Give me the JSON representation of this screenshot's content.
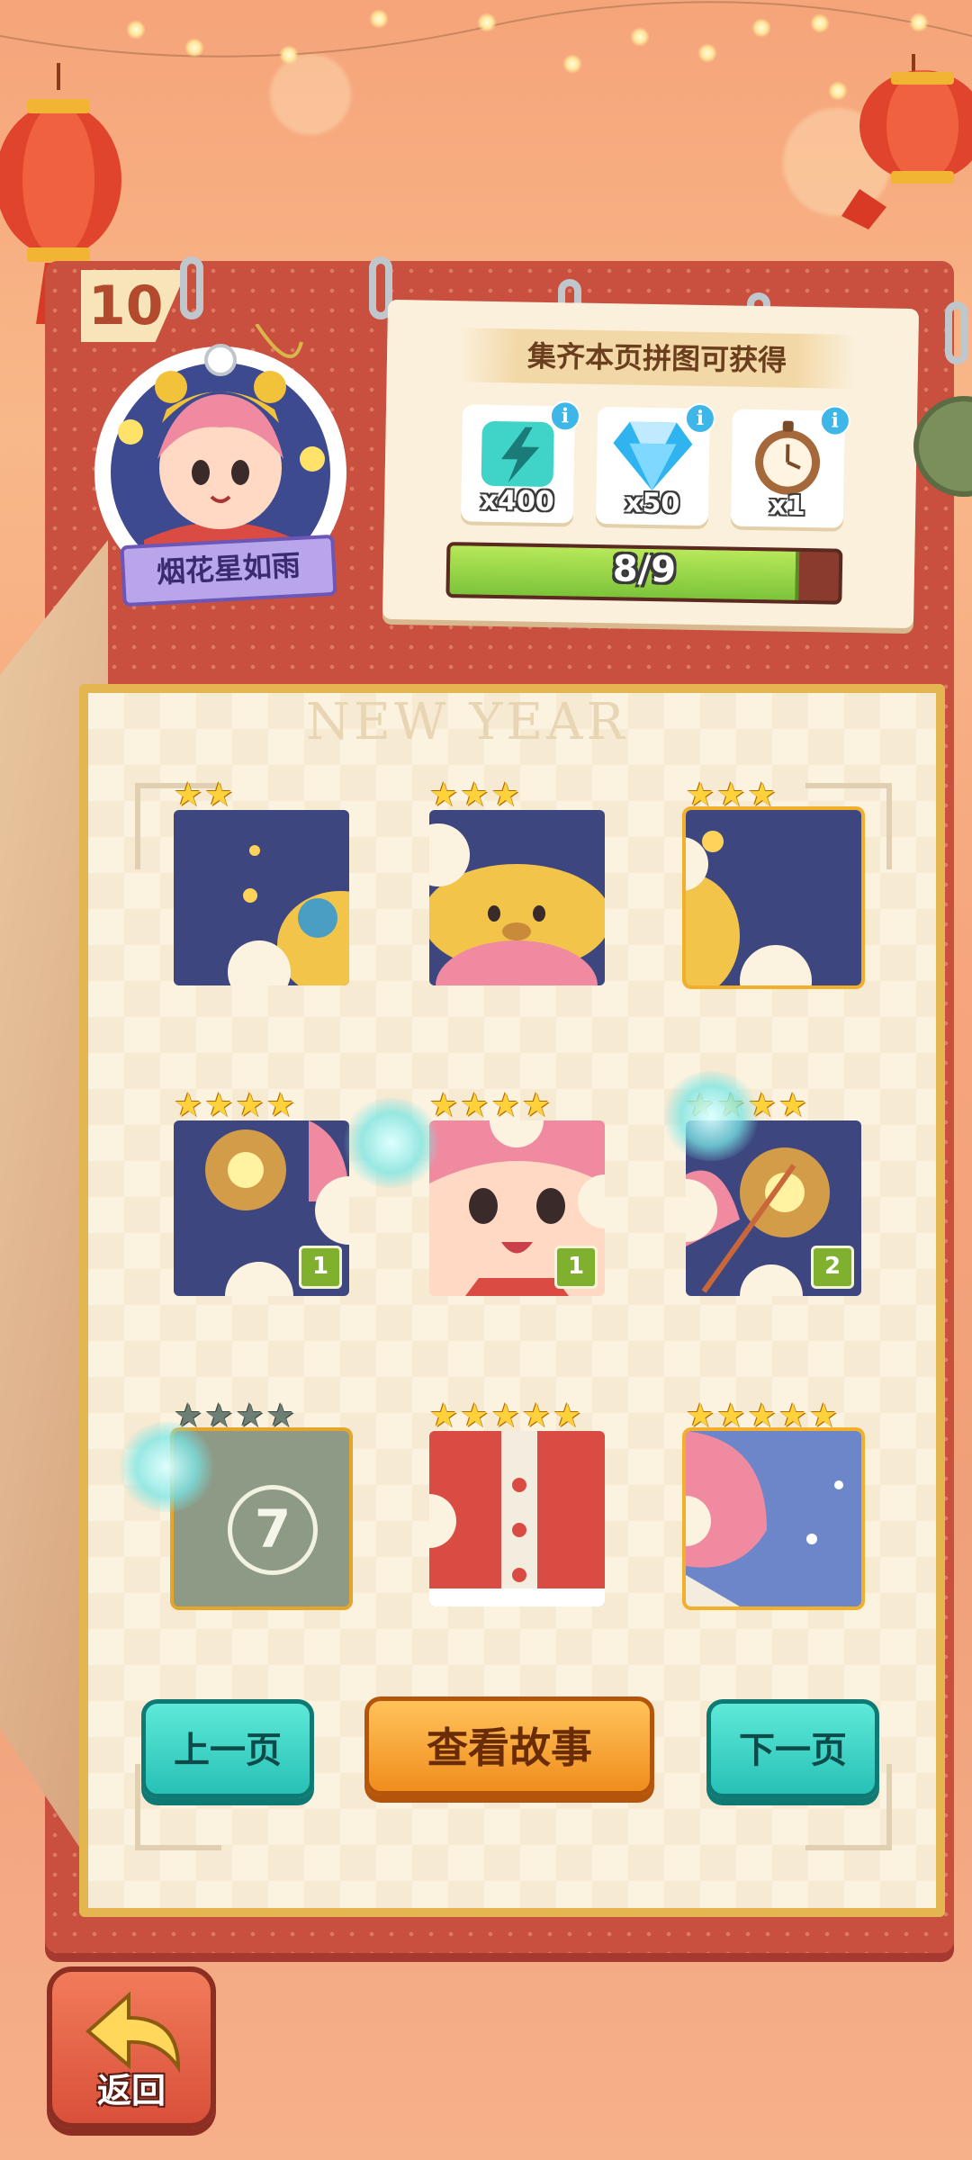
{
  "album": {
    "page_number": "10",
    "character_name": "烟花星如雨"
  },
  "rewards": {
    "title": "集齐本页拼图可获得",
    "items": [
      {
        "icon": "lightning-energy-icon",
        "count": "x400"
      },
      {
        "icon": "diamond-gem-icon",
        "count": "x50"
      },
      {
        "icon": "stopwatch-icon",
        "count": "x1"
      }
    ],
    "progress_text": "8/9",
    "progress_value": 0.8889
  },
  "background_text": "NEW YEAR",
  "pieces": [
    {
      "stars_filled": 2,
      "stars_total": 2,
      "duplicates": null,
      "locked": false
    },
    {
      "stars_filled": 3,
      "stars_total": 3,
      "duplicates": null,
      "locked": false
    },
    {
      "stars_filled": 3,
      "stars_total": 3,
      "duplicates": null,
      "locked": false
    },
    {
      "stars_filled": 4,
      "stars_total": 4,
      "duplicates": "1",
      "locked": false
    },
    {
      "stars_filled": 4,
      "stars_total": 4,
      "duplicates": "1",
      "locked": false
    },
    {
      "stars_filled": 4,
      "stars_total": 4,
      "duplicates": "2",
      "locked": false
    },
    {
      "stars_filled": 0,
      "stars_total": 4,
      "duplicates": null,
      "locked": true,
      "locked_number": "7"
    },
    {
      "stars_filled": 5,
      "stars_total": 5,
      "duplicates": null,
      "locked": false
    },
    {
      "stars_filled": 5,
      "stars_total": 5,
      "duplicates": null,
      "locked": false
    }
  ],
  "buttons": {
    "prev": "上一页",
    "story": "查看故事",
    "next": "下一页",
    "back": "返回"
  },
  "colors": {
    "background": "#f6a47a",
    "book_red": "#c9503f",
    "teal_button": "#27c1b6",
    "orange_button": "#f08d1e",
    "progress_green": "#7cc43a",
    "star_gold": "#ffd23c"
  }
}
